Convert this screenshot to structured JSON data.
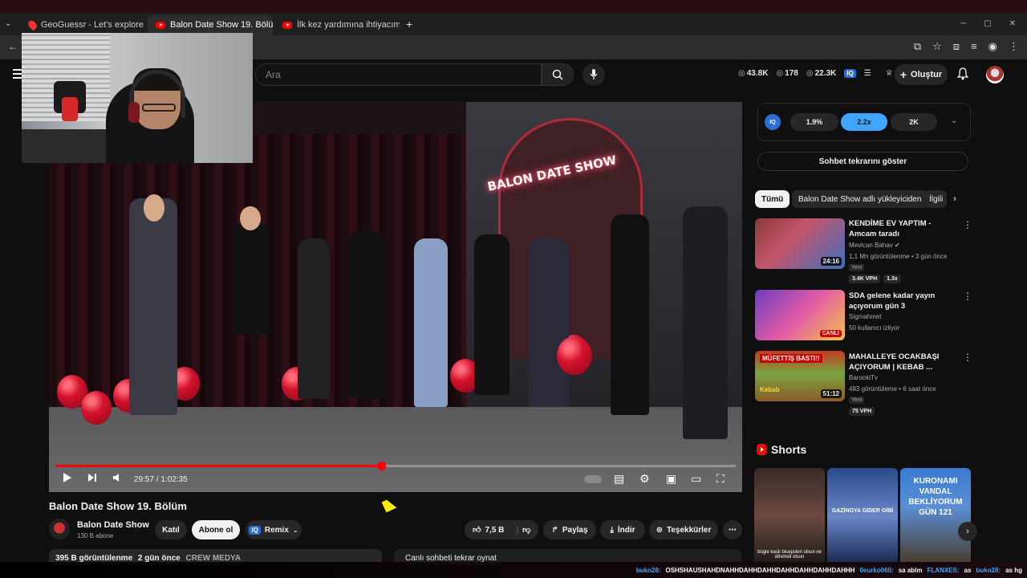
{
  "browser": {
    "tabs": [
      {
        "label": "GeoGuessr - Let's explore the w..."
      },
      {
        "label": "Balon Date Show 19. Bölüm - Y..."
      },
      {
        "label": "İlk kez yardımına ihtiyacım var..."
      }
    ],
    "new_tab": "+"
  },
  "header": {
    "search_placeholder": "Ara",
    "stats": {
      "views": "43.8K",
      "likes": "178",
      "viewers": "22.3K"
    },
    "create_label": "Oluştur"
  },
  "player": {
    "time_current": "29:57",
    "time_total": "1:02:35",
    "time_display": "29:57 / 1:02:35",
    "progress_fraction": 0.479,
    "neon_sign": "BALON DATE SHOW"
  },
  "video": {
    "title": "Balon Date Show 19. Bölüm",
    "channel": "Balon Date Show",
    "subscribers": "130 B abone",
    "join_label": "Katıl",
    "subscribe_label": "Abone ol",
    "remix_label": "Remix",
    "likes": "7,5 B",
    "share_label": "Paylaş",
    "download_label": "İndir",
    "thanks_label": "Teşekkürler",
    "views": "395 B görüntülenme",
    "published": "2 gün önce",
    "tag": "CREW MEDYA",
    "chat_replay": "Canlı sohbeti tekrar oynat"
  },
  "sidebar": {
    "speeds": [
      "1.9%",
      "2.2x",
      "2K"
    ],
    "show_chat_replay": "Sohbet tekrarını göster",
    "chips": [
      "Tümü",
      "Balon Date Show adlı yükleyiciden",
      "İlgili"
    ],
    "recommendations": [
      {
        "title": "KENDİME EV YAPTIM - Amcam taradı",
        "channel": "Mevlcan Bahav",
        "meta": "1,1 Mn görüntülenme • 3 gün önce",
        "badge": "Yeni",
        "vph": "3.4K VPH",
        "ratio": "1.3x",
        "duration": "24:16"
      },
      {
        "title": "SDA gelene kadar yayın açıyorum gün 3",
        "channel": "Sigmahmet",
        "meta": "50 kullanıcı izliyor",
        "live_label": "CANLI"
      },
      {
        "title": "MAHALLEYE OCAKBAŞI AÇIYORUM | KEBAB ...",
        "channel": "BarookiTv",
        "meta": "483 görüntüleme • 6 saat önce",
        "badge": "Yeni",
        "vph": "75 VPH",
        "duration": "51:12",
        "thumb_text": "MÜFETTİŞ BASTI!!",
        "thumb_logo": "Kebab"
      }
    ],
    "shorts_label": "Shorts",
    "shorts": [
      {
        "caption": "bügle kaslı bicepsleri olsun ve dövmeli olsun"
      },
      {
        "caption": "GAZİNOYA GİDER GİBİ"
      },
      {
        "caption": "KURONAMI VANDAL BEKLİYORUM GÜN 121"
      }
    ]
  },
  "chat_overlay": {
    "u1": "buko28:",
    "m1": "OSHSHAUSHAHDNAHHDAHHDAHHDAHHDAHHDAHHDAHHH",
    "u2": "0eurko060:",
    "m2": "sa ablm",
    "u3": "FLANXES:",
    "m3": "as",
    "u4": "buko28:",
    "m4": "as hg"
  },
  "colors": {
    "accent": "#ff0000",
    "iq_blue": "#3ea6ff",
    "background": "#0f0f0f"
  }
}
